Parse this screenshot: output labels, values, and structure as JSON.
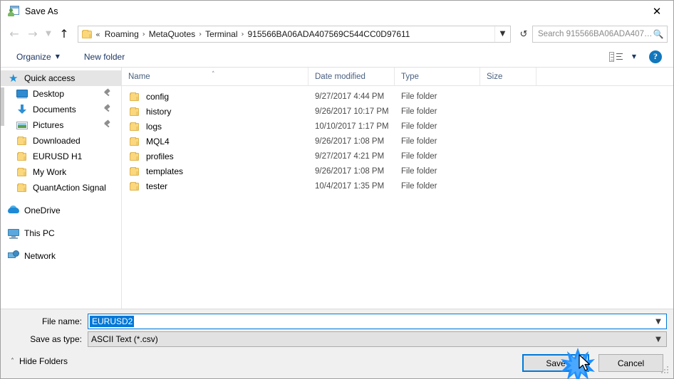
{
  "window": {
    "title": "Save As",
    "title_icon": "save-as-icon",
    "close_icon": "close-icon"
  },
  "nav": {
    "back_icon": "back-arrow-icon",
    "forward_icon": "forward-arrow-icon",
    "recent_icon": "chevron-down-icon",
    "up_icon": "up-arrow-icon",
    "breadcrumb_prefix": "«",
    "breadcrumb": [
      "Roaming",
      "MetaQuotes",
      "Terminal",
      "915566BA06ADA407569C544CC0D97611"
    ],
    "breadcrumb_separator": "›",
    "address_dropdown_icon": "chevron-down-icon",
    "refresh_icon": "refresh-icon"
  },
  "search": {
    "placeholder": "Search 915566BA06ADA40756...",
    "icon": "search-icon"
  },
  "toolbar": {
    "organize_label": "Organize",
    "organize_caret": "▼",
    "new_folder_label": "New folder",
    "view_icon": "view-layout-icon",
    "view_caret": "▼",
    "help_label": "?",
    "help_icon": "help-icon"
  },
  "sidebar": {
    "groups": [
      {
        "root": {
          "label": "Quick access",
          "icon": "star-pin-icon",
          "selected": true
        },
        "items": [
          {
            "label": "Desktop",
            "icon": "desktop-icon",
            "pinned": true
          },
          {
            "label": "Documents",
            "icon": "documents-download-icon",
            "pinned": true
          },
          {
            "label": "Pictures",
            "icon": "pictures-icon",
            "pinned": true
          },
          {
            "label": "Downloaded",
            "icon": "folder-icon",
            "pinned": false
          },
          {
            "label": "EURUSD H1",
            "icon": "folder-icon",
            "pinned": false
          },
          {
            "label": "My Work",
            "icon": "folder-icon",
            "pinned": false
          },
          {
            "label": "QuantAction Signal",
            "icon": "folder-icon",
            "pinned": false
          }
        ]
      },
      {
        "root": {
          "label": "OneDrive",
          "icon": "onedrive-cloud-icon",
          "selected": false
        },
        "items": []
      },
      {
        "root": {
          "label": "This PC",
          "icon": "this-pc-icon",
          "selected": false
        },
        "items": []
      },
      {
        "root": {
          "label": "Network",
          "icon": "network-icon",
          "selected": false
        },
        "items": []
      }
    ]
  },
  "filelist": {
    "columns": [
      "Name",
      "Date modified",
      "Type",
      "Size"
    ],
    "sort_caret": "˄",
    "rows": [
      {
        "name": "config",
        "date": "9/27/2017 4:44 PM",
        "type": "File folder",
        "size": ""
      },
      {
        "name": "history",
        "date": "9/26/2017 10:17 PM",
        "type": "File folder",
        "size": ""
      },
      {
        "name": "logs",
        "date": "10/10/2017 1:17 PM",
        "type": "File folder",
        "size": ""
      },
      {
        "name": "MQL4",
        "date": "9/26/2017 1:08 PM",
        "type": "File folder",
        "size": ""
      },
      {
        "name": "profiles",
        "date": "9/27/2017 4:21 PM",
        "type": "File folder",
        "size": ""
      },
      {
        "name": "templates",
        "date": "9/26/2017 1:08 PM",
        "type": "File folder",
        "size": ""
      },
      {
        "name": "tester",
        "date": "10/4/2017 1:35 PM",
        "type": "File folder",
        "size": ""
      }
    ]
  },
  "form": {
    "filename_label": "File name:",
    "filename_value": "EURUSD2",
    "filetype_label": "Save as type:",
    "filetype_value": "ASCII Text (*.csv)",
    "dropdown_icon": "chevron-down-icon"
  },
  "footer": {
    "hide_folders_label": "Hide Folders",
    "hide_folders_caret": "˄",
    "save_label": "Save",
    "cancel_label": "Cancel",
    "resize_grip_icon": "resize-grip-icon"
  },
  "overlay": {
    "click_burst_icon": "click-burst-icon",
    "cursor_icon": "mouse-cursor-icon",
    "burst_color": "#1e90ff"
  },
  "colors": {
    "accent": "#0078d7",
    "folder": "#fbd77d",
    "header_text": "#4a6080",
    "chrome": "#f0f0f0"
  }
}
